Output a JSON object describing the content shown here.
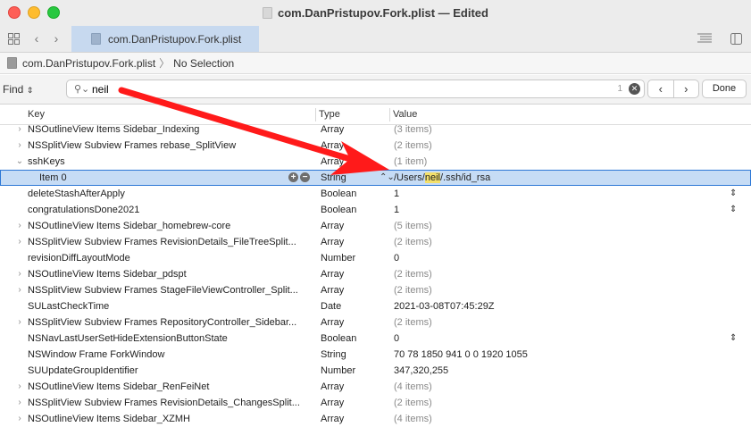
{
  "window": {
    "title": "com.DanPristupov.Fork.plist — Edited"
  },
  "toolbar": {
    "tab_label": "com.DanPristupov.Fork.plist"
  },
  "jumpbar": {
    "file": "com.DanPristupov.Fork.plist",
    "selection": "No Selection"
  },
  "find": {
    "label": "Find",
    "query": "neil",
    "match_count": "1",
    "done_label": "Done"
  },
  "columns": {
    "key": "Key",
    "type": "Type",
    "value": "Value"
  },
  "rows": [
    {
      "key": "NSOutlineView Items Sidebar_Indexing",
      "type": "Array",
      "value": "(3 items)"
    },
    {
      "key": "NSSplitView Subview Frames rebase_SplitView",
      "type": "Array",
      "value": "(2 items)"
    },
    {
      "key": "sshKeys",
      "type": "Array",
      "value": "(1 item)"
    },
    {
      "key": "Item 0",
      "type": "String",
      "value_prefix": "/Users/",
      "value_match": "neil",
      "value_suffix": "/.ssh/id_rsa"
    },
    {
      "key": "deleteStashAfterApply",
      "type": "Boolean",
      "value": "1"
    },
    {
      "key": "congratulationsDone2021",
      "type": "Boolean",
      "value": "1"
    },
    {
      "key": "NSOutlineView Items Sidebar_homebrew-core",
      "type": "Array",
      "value": "(5 items)"
    },
    {
      "key": "NSSplitView Subview Frames RevisionDetails_FileTreeSplit...",
      "type": "Array",
      "value": "(2 items)"
    },
    {
      "key": "revisionDiffLayoutMode",
      "type": "Number",
      "value": "0"
    },
    {
      "key": "NSOutlineView Items Sidebar_pdspt",
      "type": "Array",
      "value": "(2 items)"
    },
    {
      "key": "NSSplitView Subview Frames StageFileViewController_Split...",
      "type": "Array",
      "value": "(2 items)"
    },
    {
      "key": "SULastCheckTime",
      "type": "Date",
      "value": "2021-03-08T07:45:29Z"
    },
    {
      "key": "NSSplitView Subview Frames RepositoryController_Sidebar...",
      "type": "Array",
      "value": "(2 items)"
    },
    {
      "key": "NSNavLastUserSetHideExtensionButtonState",
      "type": "Boolean",
      "value": "0"
    },
    {
      "key": "NSWindow Frame ForkWindow",
      "type": "String",
      "value": "70 78 1850 941 0 0 1920 1055"
    },
    {
      "key": "SUUpdateGroupIdentifier",
      "type": "Number",
      "value": "347,320,255"
    },
    {
      "key": "NSOutlineView Items Sidebar_RenFeiNet",
      "type": "Array",
      "value": "(4 items)"
    },
    {
      "key": "NSSplitView Subview Frames RevisionDetails_ChangesSplit...",
      "type": "Array",
      "value": "(2 items)"
    },
    {
      "key": "NSOutlineView Items Sidebar_XZMH",
      "type": "Array",
      "value": "(4 items)"
    }
  ],
  "colors": {
    "selection": "#c6dcf5",
    "tab": "#c7d9ef",
    "annotation_arrow": "#ff1a1a",
    "match_highlight": "#f3e06b"
  }
}
